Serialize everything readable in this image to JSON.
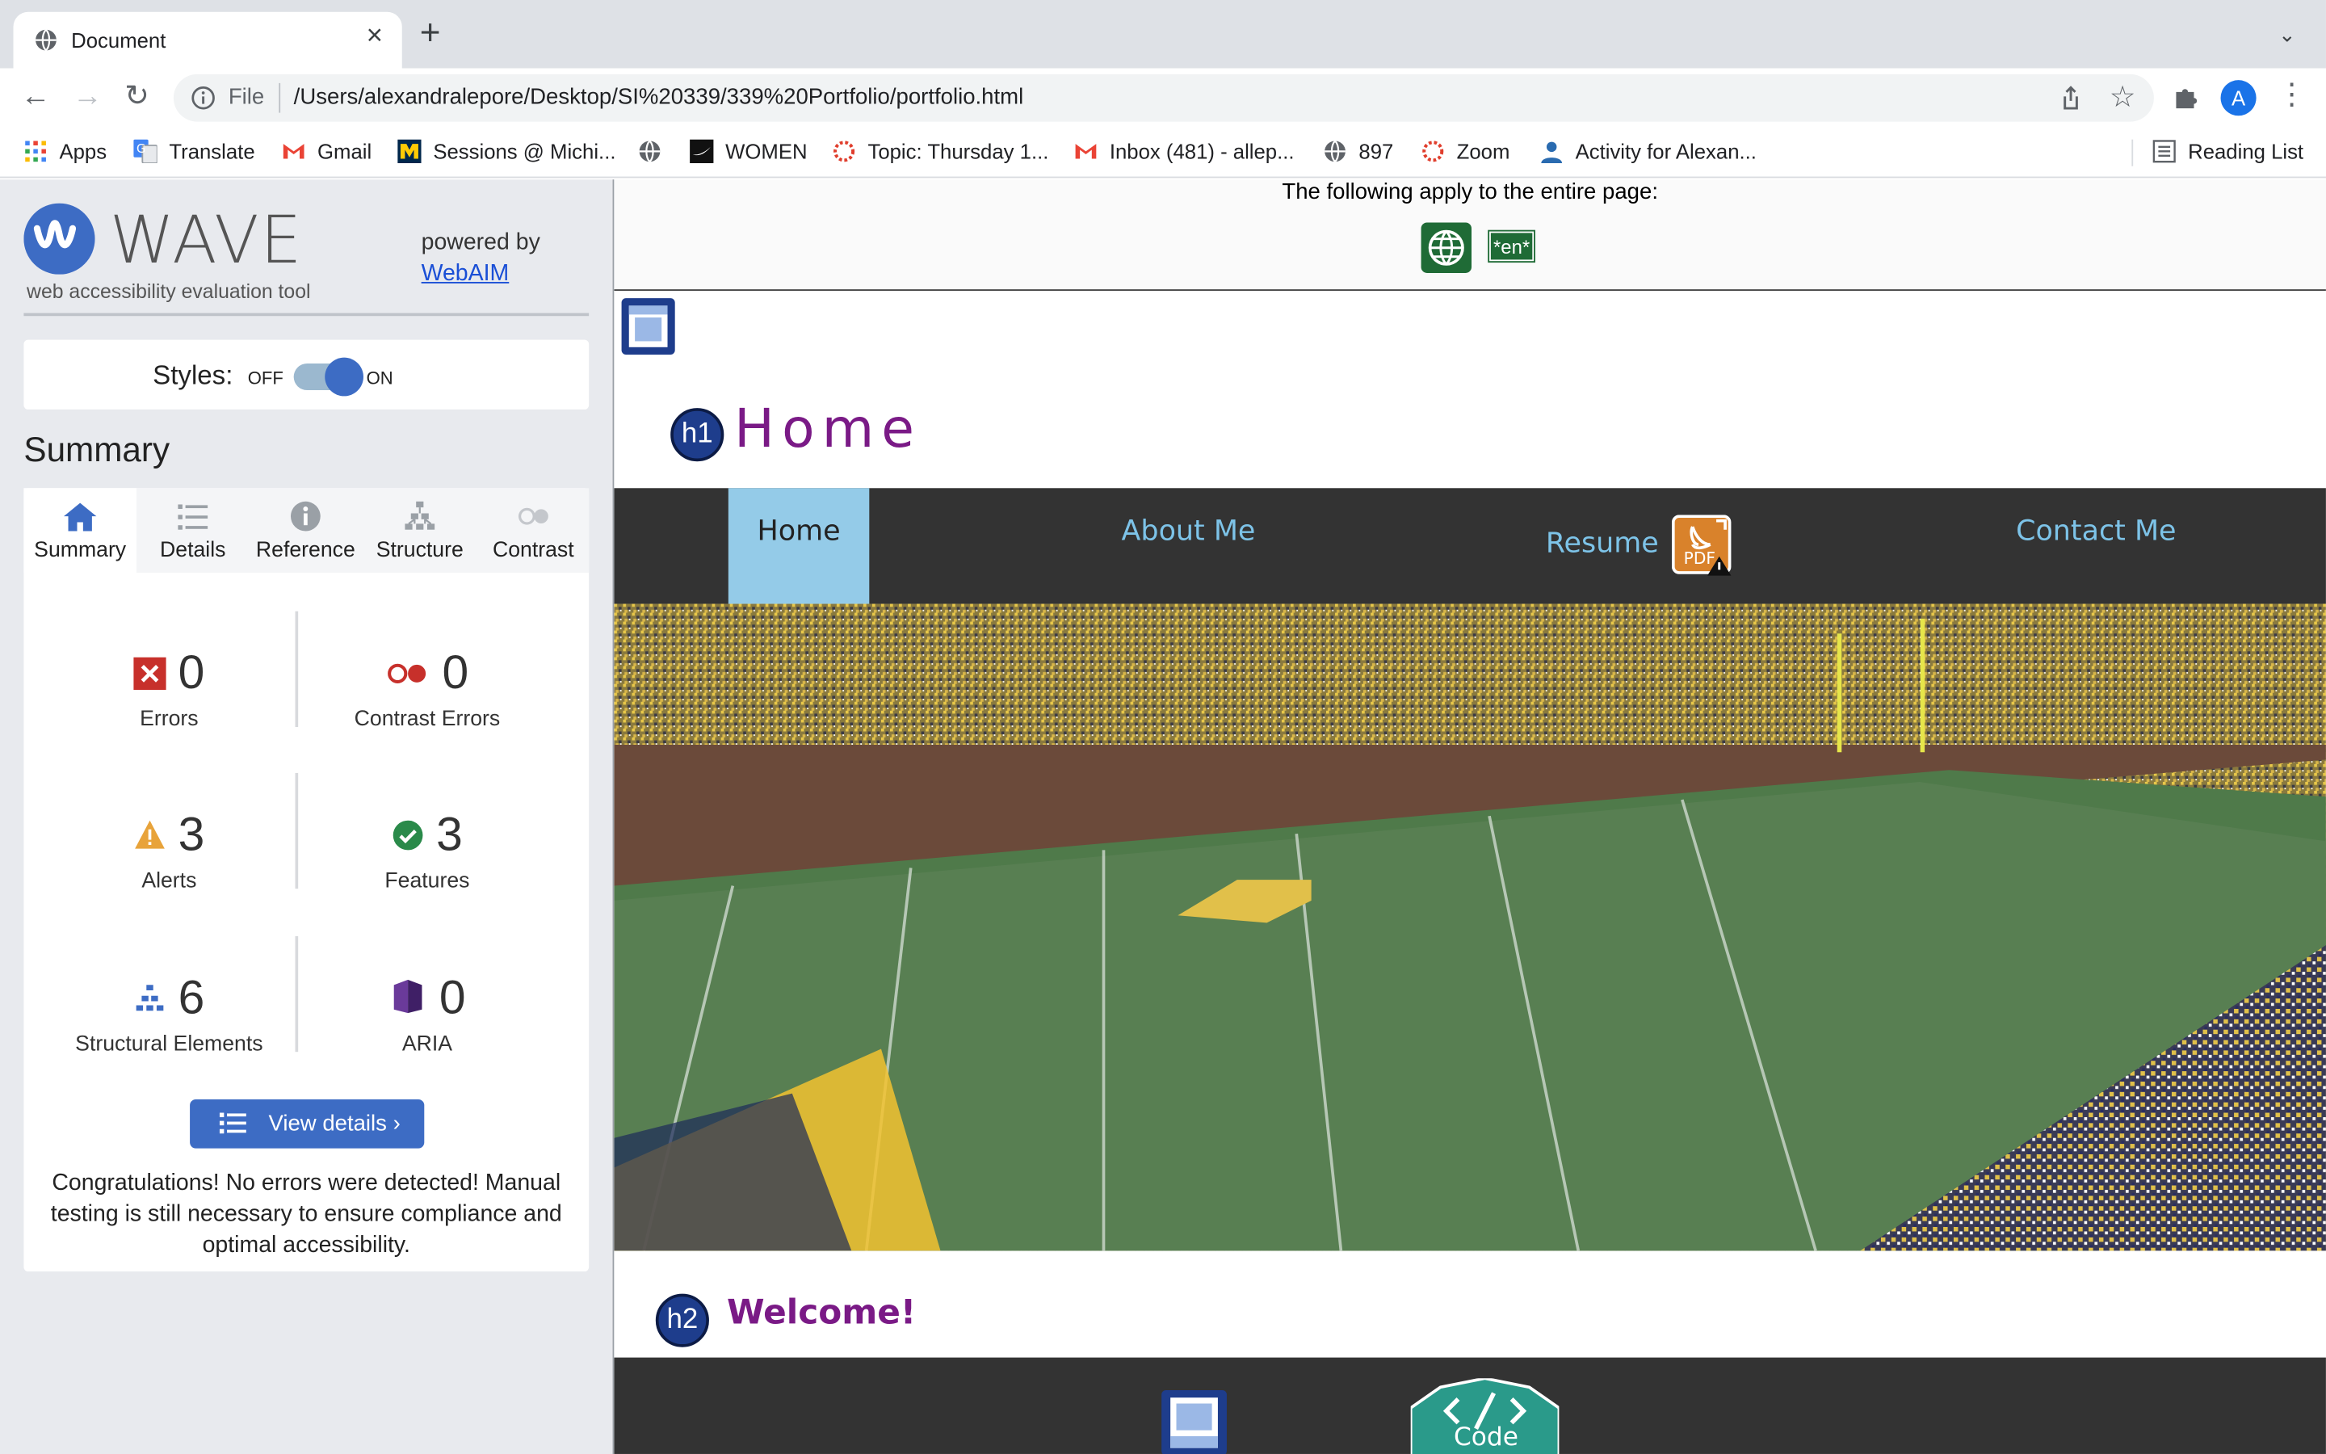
{
  "browser": {
    "tab_title": "Document",
    "url_scheme": "File",
    "url": "/Users/alexandralepore/Desktop/SI%20339/339%20Portfolio/portfolio.html",
    "avatar_letter": "A",
    "bookmarks": [
      {
        "label": "Apps",
        "icon": "apps-grid-icon"
      },
      {
        "label": "Translate",
        "icon": "google-translate-icon"
      },
      {
        "label": "Gmail",
        "icon": "gmail-icon"
      },
      {
        "label": "Sessions @ Michi...",
        "icon": "michigan-m-icon"
      },
      {
        "label": "",
        "icon": "globe-icon"
      },
      {
        "label": "WOMEN",
        "icon": "nike-icon"
      },
      {
        "label": "Topic: Thursday 1...",
        "icon": "canvas-icon"
      },
      {
        "label": "Inbox (481) - allep...",
        "icon": "gmail-icon"
      },
      {
        "label": "897",
        "icon": "globe-icon"
      },
      {
        "label": "Zoom",
        "icon": "canvas-icon"
      },
      {
        "label": "Activity for Alexan...",
        "icon": "person-icon"
      }
    ],
    "reading_list": "Reading List"
  },
  "wave": {
    "logo_text": "WAVE",
    "subtitle": "web accessibility evaluation tool",
    "powered_by": "powered by",
    "webaim": "WebAIM",
    "styles_label": "Styles:",
    "off": "OFF",
    "on": "ON",
    "summary_title": "Summary",
    "tabs": [
      {
        "label": "Summary",
        "icon": "home-icon"
      },
      {
        "label": "Details",
        "icon": "list-icon"
      },
      {
        "label": "Reference",
        "icon": "info-icon"
      },
      {
        "label": "Structure",
        "icon": "hierarchy-icon"
      },
      {
        "label": "Contrast",
        "icon": "contrast-icon"
      }
    ],
    "stats": {
      "errors": {
        "value": "0",
        "label": "Errors"
      },
      "contrast_errors": {
        "value": "0",
        "label": "Contrast Errors"
      },
      "alerts": {
        "value": "3",
        "label": "Alerts"
      },
      "features": {
        "value": "3",
        "label": "Features"
      },
      "structural": {
        "value": "6",
        "label": "Structural Elements"
      },
      "aria": {
        "value": "0",
        "label": "ARIA"
      }
    },
    "view_details": "View details ›",
    "congrats": "Congratulations! No errors were detected! Manual testing is still necessary to ensure compliance and optimal accessibility."
  },
  "page": {
    "applies_msg": "The following apply to the entire page:",
    "lang_tag": "*en*",
    "h1_badge": "h1",
    "h1_text": "Home",
    "nav": [
      "Home",
      "About Me",
      "Resume",
      "Contact Me"
    ],
    "h2_badge": "h2",
    "h2_text": "Welcome!",
    "code_label": "Code"
  },
  "colors": {
    "wave_blue": "#3d6cc4",
    "heading_purple": "#7a1a86",
    "nav_bg": "#333333",
    "nav_link": "#7dc3e8",
    "nav_active": "#94cbe8",
    "feature_green": "#1f6b36"
  }
}
